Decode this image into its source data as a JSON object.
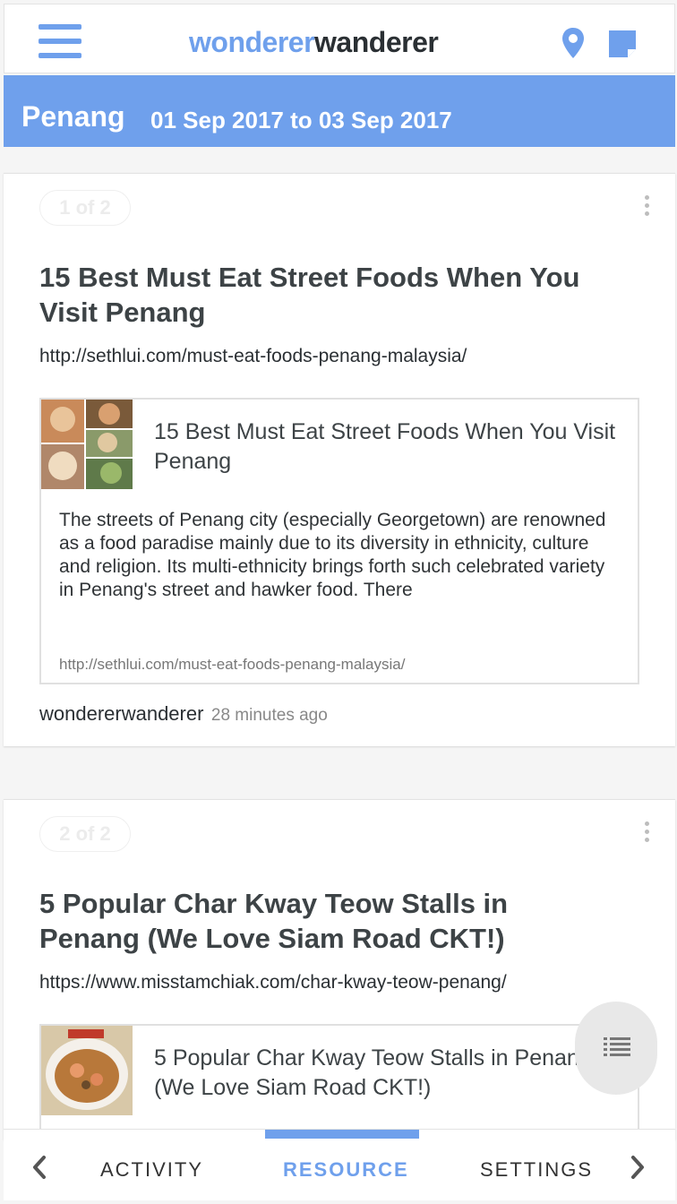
{
  "app": {
    "logo_part1": "wonderer",
    "logo_part2": "wanderer"
  },
  "header": {
    "city": "Penang",
    "dates": "01 Sep 2017 to 03 Sep 2017"
  },
  "posts": [
    {
      "pager": "1 of 2",
      "title": "15 Best Must Eat Street Foods When You Visit Penang",
      "url": "http://sethlui.com/must-eat-foods-penang-malaysia/",
      "preview": {
        "title": "15 Best Must Eat Street Foods When You Visit Penang",
        "description": "The streets of Penang city (especially Georgetown) are renowned as a food paradise mainly due to its diversity in ethnicity, culture and religion. Its multi-ethnicity brings forth such celebrated variety in Penang's street and hawker food. There",
        "url": "http://sethlui.com/must-eat-foods-penang-malaysia/"
      },
      "author": "wondererwanderer",
      "time": "28 minutes ago"
    },
    {
      "pager": "2 of 2",
      "title": "5 Popular Char Kway Teow Stalls in Penang (We Love Siam Road CKT!)",
      "url": "https://www.misstamchiak.com/char-kway-teow-penang/",
      "preview": {
        "title": "5 Popular Char Kway Teow Stalls in Penang (We Love Siam Road CKT!)"
      }
    }
  ],
  "tabs": {
    "activity": "ACTIVITY",
    "resource": "RESOURCE",
    "settings": "SETTINGS",
    "active": "RESOURCE"
  },
  "icons": {
    "menu": "hamburger-icon",
    "location": "map-pin-icon",
    "notes": "note-icon",
    "more": "more-vertical-icon",
    "list": "list-icon",
    "prev": "chevron-left-icon",
    "next": "chevron-right-icon"
  },
  "colors": {
    "accent": "#6fa0ec",
    "text": "#3d4346"
  }
}
